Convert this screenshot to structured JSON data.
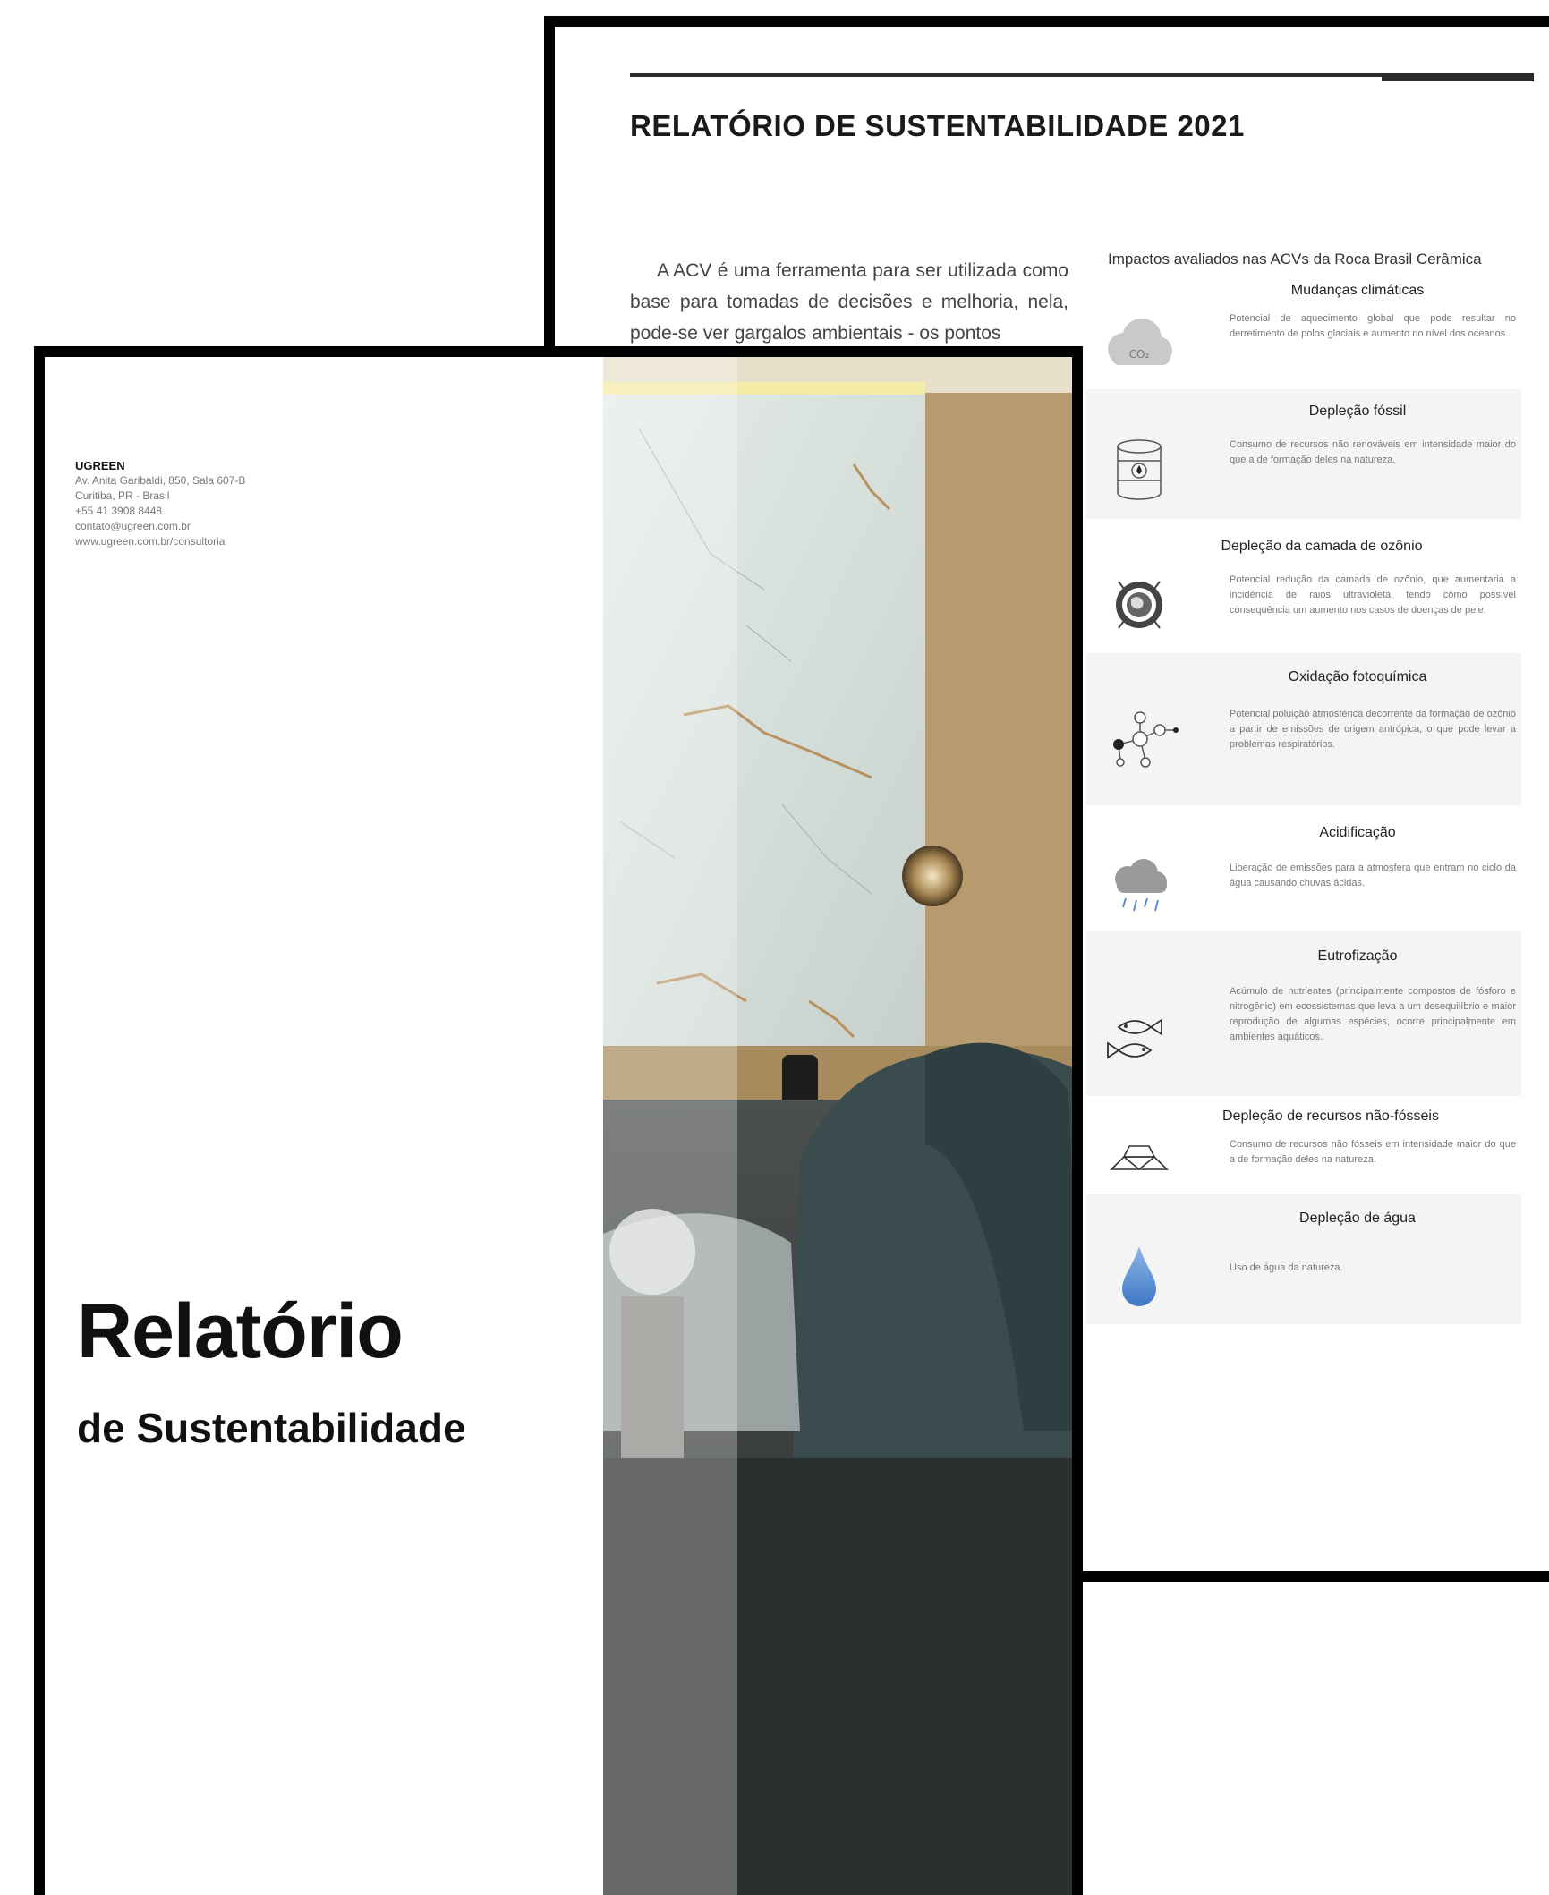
{
  "back_page": {
    "title": "RELATÓRIO DE SUSTENTABILIDADE 2021",
    "body": "A ACV é uma ferramenta para ser utilizada como base para tomadas de decisões e melhoria, nela, pode-se ver gargalos ambientais - os pontos",
    "impacts_heading": "Impactos avaliados nas ACVs da Roca Brasil Cerâmica",
    "impacts": [
      {
        "title": "Mudanças climáticas",
        "desc": "Potencial de aquecimento global que pode resultar no derretimento de polos glaciais e aumento no nível dos oceanos.",
        "icon": "co2-cloud-icon",
        "icon_text": "CO₂"
      },
      {
        "title": "Depleção fóssil",
        "desc": "Consumo de recursos não renováveis em intensidade maior do que a de formação deles na natureza.",
        "icon": "oil-barrel-icon"
      },
      {
        "title": "Depleção da camada de ozônio",
        "desc": "Potencial redução da camada de ozônio, que aumentaria a incidência de raios ultravioleta, tendo como possível consequência um aumento nos casos de doenças de pele.",
        "icon": "ozone-globe-icon"
      },
      {
        "title": "Oxidação fotoquímica",
        "desc": "Potencial poluição atmosférica decorrente da formação de ozônio a partir de emissões de origem antrópica, o que pode levar a problemas respiratórios.",
        "icon": "molecule-icon"
      },
      {
        "title": "Acidificação",
        "desc": "Liberação de emissões para a atmosfera que entram no ciclo da água causando chuvas ácidas.",
        "icon": "acid-rain-cloud-icon"
      },
      {
        "title": "Eutrofização",
        "desc": "Acúmulo de nutrientes (principalmente compostos de fósforo e nitrogênio) em ecossistemas que leva a um desequilíbrio e maior reprodução de algumas espécies, ocorre principalmente em ambientes aquáticos.",
        "icon": "fish-icon"
      },
      {
        "title": "Depleção de recursos não-fósseis",
        "desc": "Consumo de recursos não fósseis em intensidade maior do que a de formação deles na natureza.",
        "icon": "ingots-icon"
      },
      {
        "title": "Depleção de água",
        "desc": "Uso de água da natureza.",
        "icon": "water-drop-icon"
      }
    ]
  },
  "cover": {
    "brand": "UGREEN",
    "address_line1": "Av. Anita Garibaldi, 850, Sala 607-B",
    "address_line2": "Curitiba, PR - Brasil",
    "phone": "+55 41 3908 8448",
    "email": "contato@ugreen.com.br",
    "website": "www.ugreen.com.br/consultoria",
    "title": "Relatório",
    "subtitle": "de Sustentabilidade"
  }
}
